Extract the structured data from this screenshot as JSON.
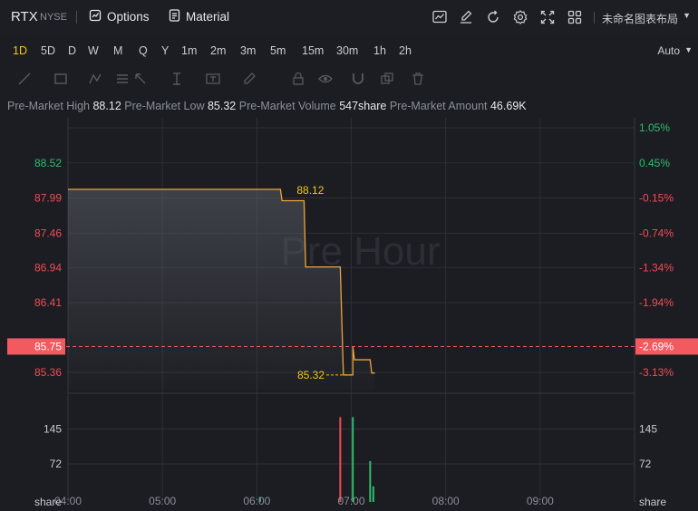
{
  "header": {
    "symbol": "RTX",
    "exchange": "NYSE",
    "options_label": "Options",
    "material_label": "Material",
    "layout_name": "未命名图表布局",
    "icons": [
      "chart-icon",
      "edit-icon",
      "refresh-icon",
      "settings-icon",
      "fullscreen-icon",
      "grid-layout-icon"
    ]
  },
  "intervals": [
    "1D",
    "5D",
    "D",
    "W",
    "M",
    "Q",
    "Y",
    "1m",
    "2m",
    "3m",
    "5m",
    "15m",
    "30m",
    "1h",
    "2h"
  ],
  "active_interval": "1D",
  "scale_mode": "Auto",
  "drawing_tools": [
    "line-tool-icon",
    "rectangle-tool-icon",
    "pattern-tool-icon",
    "fib-tool-icon",
    "arrow-tool-icon",
    "measure-tool-icon",
    "text-tool-icon",
    "pencil-icon",
    "lock-icon",
    "eye-icon",
    "magnet-icon",
    "duplicate-icon",
    "trash-icon"
  ],
  "stats": {
    "high_label": "Pre-Market High",
    "high_value": "88.12",
    "low_label": "Pre-Market Low",
    "low_value": "85.32",
    "volume_label": "Pre-Market Volume",
    "volume_value": "547share",
    "amount_label": "Pre-Market Amount",
    "amount_value": "46.69K"
  },
  "colors": {
    "up": "#2ebd6b",
    "down": "#f24b55",
    "line": "#f0a23a",
    "accent": "#f5c518",
    "current": "#f25a5f"
  },
  "chart_data": {
    "type": "line",
    "watermark": "Pre Hour",
    "x_ticks": [
      "04:00",
      "05:00",
      "06:00",
      "07:00",
      "08:00",
      "09:00"
    ],
    "price_axis_left": [
      {
        "value": 88.52,
        "label": "88.52",
        "color": "up"
      },
      {
        "value": 87.99,
        "label": "87.99",
        "color": "down"
      },
      {
        "value": 87.46,
        "label": "87.46",
        "color": "down"
      },
      {
        "value": 86.94,
        "label": "86.94",
        "color": "down"
      },
      {
        "value": 86.41,
        "label": "86.41",
        "color": "down"
      },
      {
        "value": 85.36,
        "label": "85.36",
        "color": "down"
      }
    ],
    "percent_axis_right": [
      {
        "value": 89.05,
        "label": "1.05%",
        "color": "up"
      },
      {
        "value": 88.52,
        "label": "0.45%",
        "color": "up"
      },
      {
        "value": 87.99,
        "label": "-0.15%",
        "color": "down"
      },
      {
        "value": 87.46,
        "label": "-0.74%",
        "color": "down"
      },
      {
        "value": 86.94,
        "label": "-1.34%",
        "color": "down"
      },
      {
        "value": 86.41,
        "label": "-1.94%",
        "color": "down"
      },
      {
        "value": 85.36,
        "label": "-3.13%",
        "color": "down"
      }
    ],
    "current_price": {
      "value": 85.75,
      "label": "85.75",
      "percent": "-2.69%"
    },
    "high_marker": {
      "time": "06:15",
      "value": 88.12,
      "label": "88.12"
    },
    "low_marker": {
      "time": "06:58",
      "value": 85.32,
      "label": "85.32"
    },
    "price_series": [
      {
        "t": "04:00",
        "v": 88.12
      },
      {
        "t": "06:15",
        "v": 88.12
      },
      {
        "t": "06:16",
        "v": 87.95
      },
      {
        "t": "06:30",
        "v": 87.95
      },
      {
        "t": "06:31",
        "v": 86.95
      },
      {
        "t": "06:53",
        "v": 86.95
      },
      {
        "t": "06:55",
        "v": 85.32
      },
      {
        "t": "07:01",
        "v": 85.32
      },
      {
        "t": "07:01",
        "v": 85.75
      },
      {
        "t": "07:02",
        "v": 85.55
      },
      {
        "t": "07:12",
        "v": 85.55
      },
      {
        "t": "07:13",
        "v": 85.35
      },
      {
        "t": "07:15",
        "v": 85.35
      }
    ],
    "ylim": [
      85.1,
      89.2
    ],
    "volume_axis": [
      {
        "value": 145,
        "label": "145"
      },
      {
        "value": 72,
        "label": "72"
      }
    ],
    "volume_unit": "share",
    "volume_ylim": [
      0,
      220
    ],
    "volume_series": [
      {
        "t": "06:02",
        "v": 3,
        "dir": "up"
      },
      {
        "t": "06:53",
        "v": 170,
        "dir": "down"
      },
      {
        "t": "07:01",
        "v": 170,
        "dir": "up"
      },
      {
        "t": "07:12",
        "v": 78,
        "dir": "up"
      },
      {
        "t": "07:14",
        "v": 25,
        "dir": "up"
      }
    ]
  }
}
